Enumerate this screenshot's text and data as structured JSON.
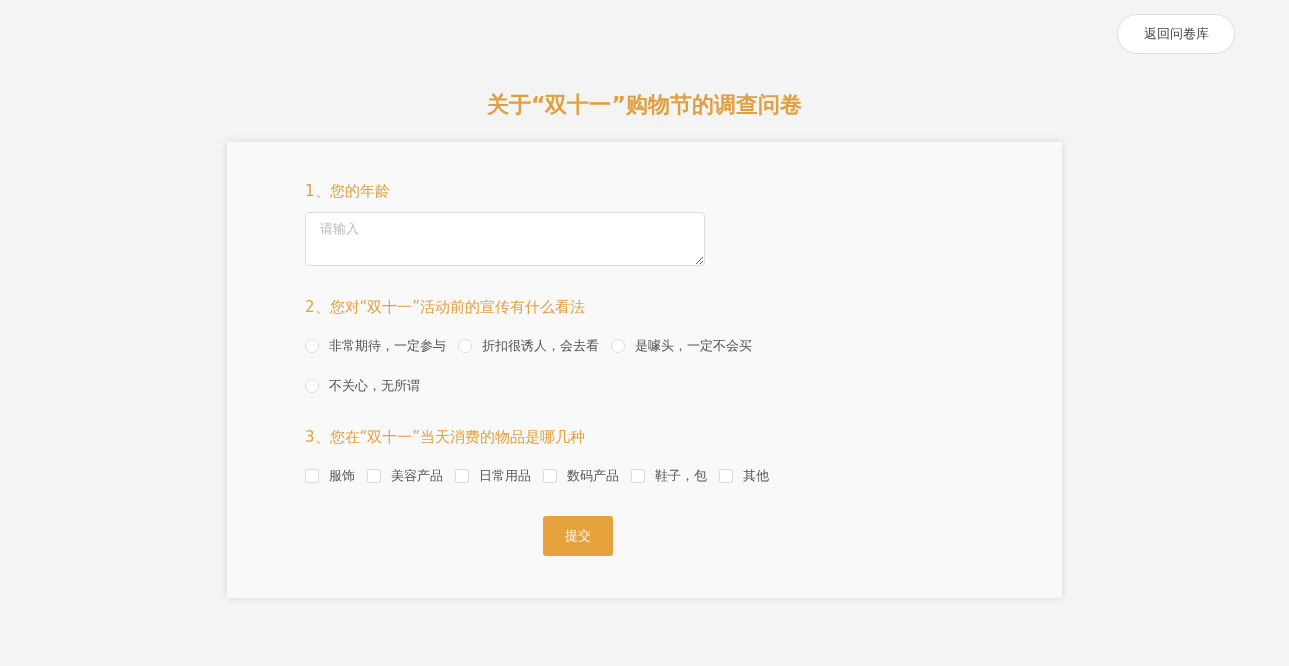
{
  "back_button": {
    "label": "返回问卷库"
  },
  "title": "关于“双十一”购物节的调查问卷",
  "questions": [
    {
      "kind": "text",
      "label": "1、您的年龄",
      "placeholder": "请输入"
    },
    {
      "kind": "radio",
      "label": "2、您对“双十一”活动前的宣传有什么看法",
      "options": [
        {
          "label": "非常期待，一定参与",
          "selected": false
        },
        {
          "label": "折扣很诱人，会去看",
          "selected": false
        },
        {
          "label": "是噱头，一定不会买",
          "selected": false
        },
        {
          "label": "不关心，无所谓",
          "selected": false
        }
      ]
    },
    {
      "kind": "checkbox",
      "label": "3、您在“双十一”当天消费的物品是哪几种",
      "options": [
        {
          "label": "服饰",
          "checked": false
        },
        {
          "label": "美容产品",
          "checked": false
        },
        {
          "label": "日常用品",
          "checked": false
        },
        {
          "label": "数码产品",
          "checked": false
        },
        {
          "label": "鞋子，包",
          "checked": false
        },
        {
          "label": "其他",
          "checked": false
        }
      ]
    }
  ],
  "submit_button": {
    "label": "提交"
  }
}
